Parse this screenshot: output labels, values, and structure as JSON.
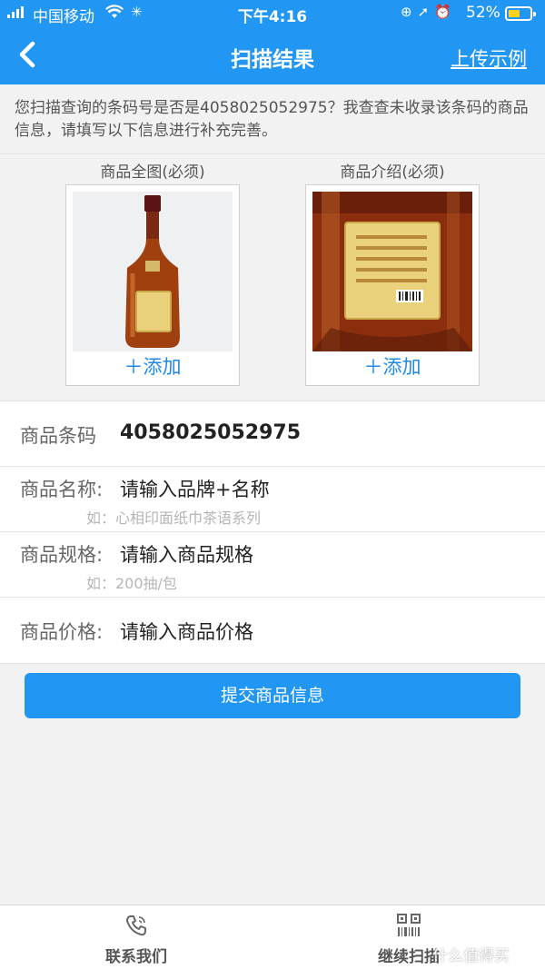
{
  "status_bar": {
    "carrier": "中国移动",
    "time": "下午4:16",
    "battery_percent": "52%",
    "battery_level": 0.52,
    "battery_color": "#ffd21f"
  },
  "nav": {
    "title": "扫描结果",
    "action_label": "上传示例",
    "back_icon": "chevron-left-icon"
  },
  "notice": "您扫描查询的条码号是否是4058025052975？我查查未收录该条码的商品信息，请填写以下信息进行补充完善。",
  "photos": [
    {
      "caption": "商品全图(必须)",
      "add_label": "＋添加"
    },
    {
      "caption": "商品介绍(必须)",
      "add_label": "＋添加"
    }
  ],
  "form": {
    "barcode": {
      "label": "商品条码",
      "value": "4058025052975"
    },
    "name": {
      "label": "商品名称:",
      "placeholder": "请输入品牌+名称",
      "hint": "如：心相印面纸巾茶语系列"
    },
    "spec": {
      "label": "商品规格:",
      "placeholder": "请输入商品规格",
      "hint": "如：200抽/包"
    },
    "price": {
      "label": "商品价格:",
      "placeholder": "请输入商品价格"
    }
  },
  "submit_label": "提交商品信息",
  "tabbar": [
    {
      "label": "联系我们",
      "icon": "phone-icon"
    },
    {
      "label": "继续扫描",
      "icon": "qr-code-icon"
    }
  ],
  "watermark": "什么值得买",
  "colors": {
    "primary": "#2196f3",
    "link": "#1e88e5",
    "background": "#f2f2f2"
  }
}
